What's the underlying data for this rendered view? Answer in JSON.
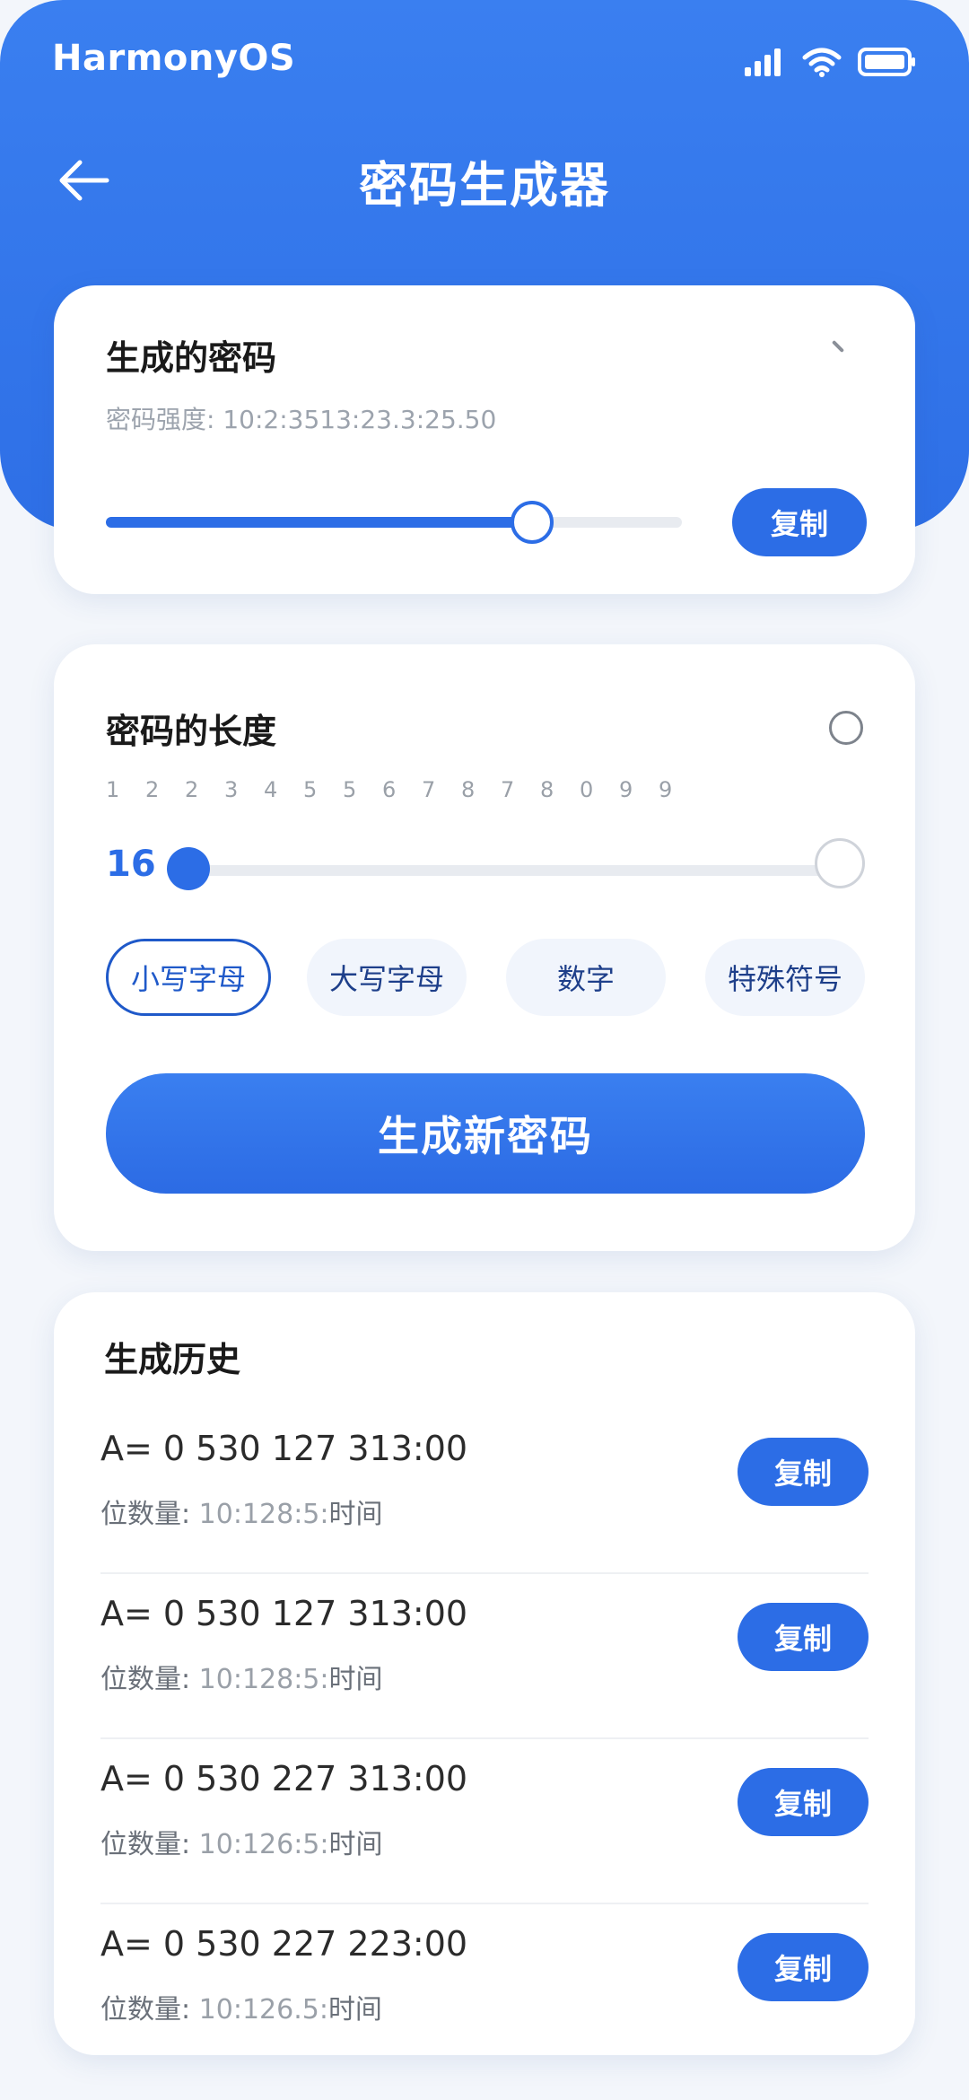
{
  "status_bar": {
    "brand": "HarmonyOS",
    "icons": [
      "signal-icon",
      "wifi-icon",
      "battery-icon"
    ]
  },
  "header": {
    "title": "密码生成器",
    "back_icon": "back-arrow-icon"
  },
  "generated_card": {
    "title": "生成的密码",
    "strength_label": "密码强度:",
    "strength_value": "10:2:3513:23.3:25.50",
    "slider_fraction": 0.74,
    "copy_label": "复制"
  },
  "length_card": {
    "title": "密码的长度",
    "ticks": [
      "1",
      "2",
      "2",
      "3",
      "4",
      "5",
      "5",
      "6",
      "7",
      "8",
      "7",
      "8",
      "0",
      "9",
      "9"
    ],
    "length_value": "16",
    "slider_fraction": 0.0,
    "options": [
      {
        "label": "小写字母",
        "active": true
      },
      {
        "label": "大写字母",
        "active": false
      },
      {
        "label": "数字",
        "active": false
      },
      {
        "label": "特殊符号",
        "active": false
      }
    ],
    "generate_label": "生成新密码"
  },
  "history_card": {
    "title": "生成历史",
    "items": [
      {
        "password": "A= 0 530 127 313:00",
        "meta_label": "位数量:",
        "meta_value": "10:128:5:",
        "meta_suffix": "时间",
        "copy_label": "复制"
      },
      {
        "password": "A= 0 530 127 313:00",
        "meta_label": "位数量:",
        "meta_value": "10:128:5:",
        "meta_suffix": "时间",
        "copy_label": "复制"
      },
      {
        "password": "A= 0 530 227 313:00",
        "meta_label": "位数量:",
        "meta_value": "10:126:5:",
        "meta_suffix": "时间",
        "copy_label": "复制"
      },
      {
        "password": "A= 0 530 227 223:00",
        "meta_label": "位数量:",
        "meta_value": "10:126.5:",
        "meta_suffix": "时间",
        "copy_label": "复制"
      }
    ]
  },
  "colors": {
    "primary": "#2c6de6",
    "hero": "#3a7ff0",
    "background": "#f3f6fb"
  }
}
